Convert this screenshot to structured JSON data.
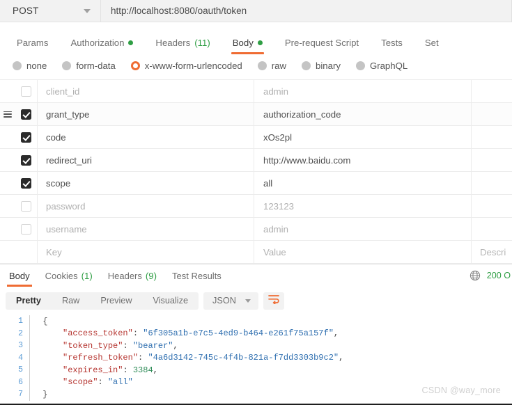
{
  "request": {
    "method": "POST",
    "url": "http://localhost:8080/oauth/token",
    "tabs": [
      {
        "label": "Params",
        "count": "",
        "dot": false,
        "active": false
      },
      {
        "label": "Authorization",
        "count": "",
        "dot": true,
        "active": false
      },
      {
        "label": "Headers",
        "count": "(11)",
        "dot": false,
        "active": false
      },
      {
        "label": "Body",
        "count": "",
        "dot": true,
        "active": true
      },
      {
        "label": "Pre-request Script",
        "count": "",
        "dot": false,
        "active": false
      },
      {
        "label": "Tests",
        "count": "",
        "dot": false,
        "active": false
      },
      {
        "label": "Set",
        "count": "",
        "dot": false,
        "active": false
      }
    ],
    "body_types": [
      {
        "label": "none",
        "selected": false
      },
      {
        "label": "form-data",
        "selected": false
      },
      {
        "label": "x-www-form-urlencoded",
        "selected": true
      },
      {
        "label": "raw",
        "selected": false
      },
      {
        "label": "binary",
        "selected": false
      },
      {
        "label": "GraphQL",
        "selected": false
      }
    ],
    "table": {
      "columns": {
        "key": "Key",
        "value": "Value",
        "description": "Descri"
      },
      "rows": [
        {
          "checked": false,
          "key": "client_id",
          "value": "admin",
          "description": "",
          "enabled": false,
          "hovered": false
        },
        {
          "checked": true,
          "key": "grant_type",
          "value": "authorization_code",
          "description": "",
          "enabled": true,
          "hovered": true
        },
        {
          "checked": true,
          "key": "code",
          "value": "xOs2pl",
          "description": "",
          "enabled": true,
          "hovered": false
        },
        {
          "checked": true,
          "key": "redirect_uri",
          "value": "http://www.baidu.com",
          "description": "",
          "enabled": true,
          "hovered": false
        },
        {
          "checked": true,
          "key": "scope",
          "value": "all",
          "description": "",
          "enabled": true,
          "hovered": false
        },
        {
          "checked": false,
          "key": "password",
          "value": "123123",
          "description": "",
          "enabled": false,
          "hovered": false
        },
        {
          "checked": false,
          "key": "username",
          "value": "admin",
          "description": "",
          "enabled": false,
          "hovered": false
        }
      ]
    }
  },
  "response": {
    "tabs": [
      {
        "label": "Body",
        "count": "",
        "active": true
      },
      {
        "label": "Cookies",
        "count": "(1)",
        "active": false
      },
      {
        "label": "Headers",
        "count": "(9)",
        "active": false
      },
      {
        "label": "Test Results",
        "count": "",
        "active": false
      }
    ],
    "status": "200 O",
    "status_color": "#2f9e44",
    "view_modes": [
      {
        "label": "Pretty",
        "active": true
      },
      {
        "label": "Raw",
        "active": false
      },
      {
        "label": "Preview",
        "active": false
      },
      {
        "label": "Visualize",
        "active": false
      }
    ],
    "format": "JSON",
    "wrap_icon": "text-wrap-icon",
    "globe_icon": "globe-icon",
    "body_lines": [
      {
        "num": "1",
        "indent": 0,
        "tokens": [
          {
            "t": "{",
            "c": "tk-brace"
          }
        ]
      },
      {
        "num": "2",
        "indent": 1,
        "tokens": [
          {
            "t": "\"access_token\"",
            "c": "tk-key"
          },
          {
            "t": ": ",
            "c": "tk-punc"
          },
          {
            "t": "\"6f305a1b-e7c5-4ed9-b464-e261f75a157f\"",
            "c": "tk-str"
          },
          {
            "t": ",",
            "c": "tk-punc"
          }
        ]
      },
      {
        "num": "3",
        "indent": 1,
        "tokens": [
          {
            "t": "\"token_type\"",
            "c": "tk-key"
          },
          {
            "t": ": ",
            "c": "tk-punc"
          },
          {
            "t": "\"bearer\"",
            "c": "tk-str"
          },
          {
            "t": ",",
            "c": "tk-punc"
          }
        ]
      },
      {
        "num": "4",
        "indent": 1,
        "tokens": [
          {
            "t": "\"refresh_token\"",
            "c": "tk-key"
          },
          {
            "t": ": ",
            "c": "tk-punc"
          },
          {
            "t": "\"4a6d3142-745c-4f4b-821a-f7dd3303b9c2\"",
            "c": "tk-str"
          },
          {
            "t": ",",
            "c": "tk-punc"
          }
        ]
      },
      {
        "num": "5",
        "indent": 1,
        "tokens": [
          {
            "t": "\"expires_in\"",
            "c": "tk-key"
          },
          {
            "t": ": ",
            "c": "tk-punc"
          },
          {
            "t": "3384",
            "c": "tk-num"
          },
          {
            "t": ",",
            "c": "tk-punc"
          }
        ]
      },
      {
        "num": "6",
        "indent": 1,
        "tokens": [
          {
            "t": "\"scope\"",
            "c": "tk-key"
          },
          {
            "t": ": ",
            "c": "tk-punc"
          },
          {
            "t": "\"all\"",
            "c": "tk-str"
          }
        ]
      },
      {
        "num": "7",
        "indent": 0,
        "tokens": [
          {
            "t": "}",
            "c": "tk-brace"
          }
        ]
      }
    ],
    "parsed_body": {
      "access_token": "6f305a1b-e7c5-4ed9-b464-e261f75a157f",
      "token_type": "bearer",
      "refresh_token": "4a6d3142-745c-4f4b-821a-f7dd3303b9c2",
      "expires_in": 3384,
      "scope": "all"
    }
  },
  "watermark": "CSDN @way_more",
  "colors": {
    "accent": "#ef6c33",
    "success": "#2f9e44",
    "text": "#4f4f4f",
    "muted": "#b0b0b0",
    "border": "#ececec"
  }
}
